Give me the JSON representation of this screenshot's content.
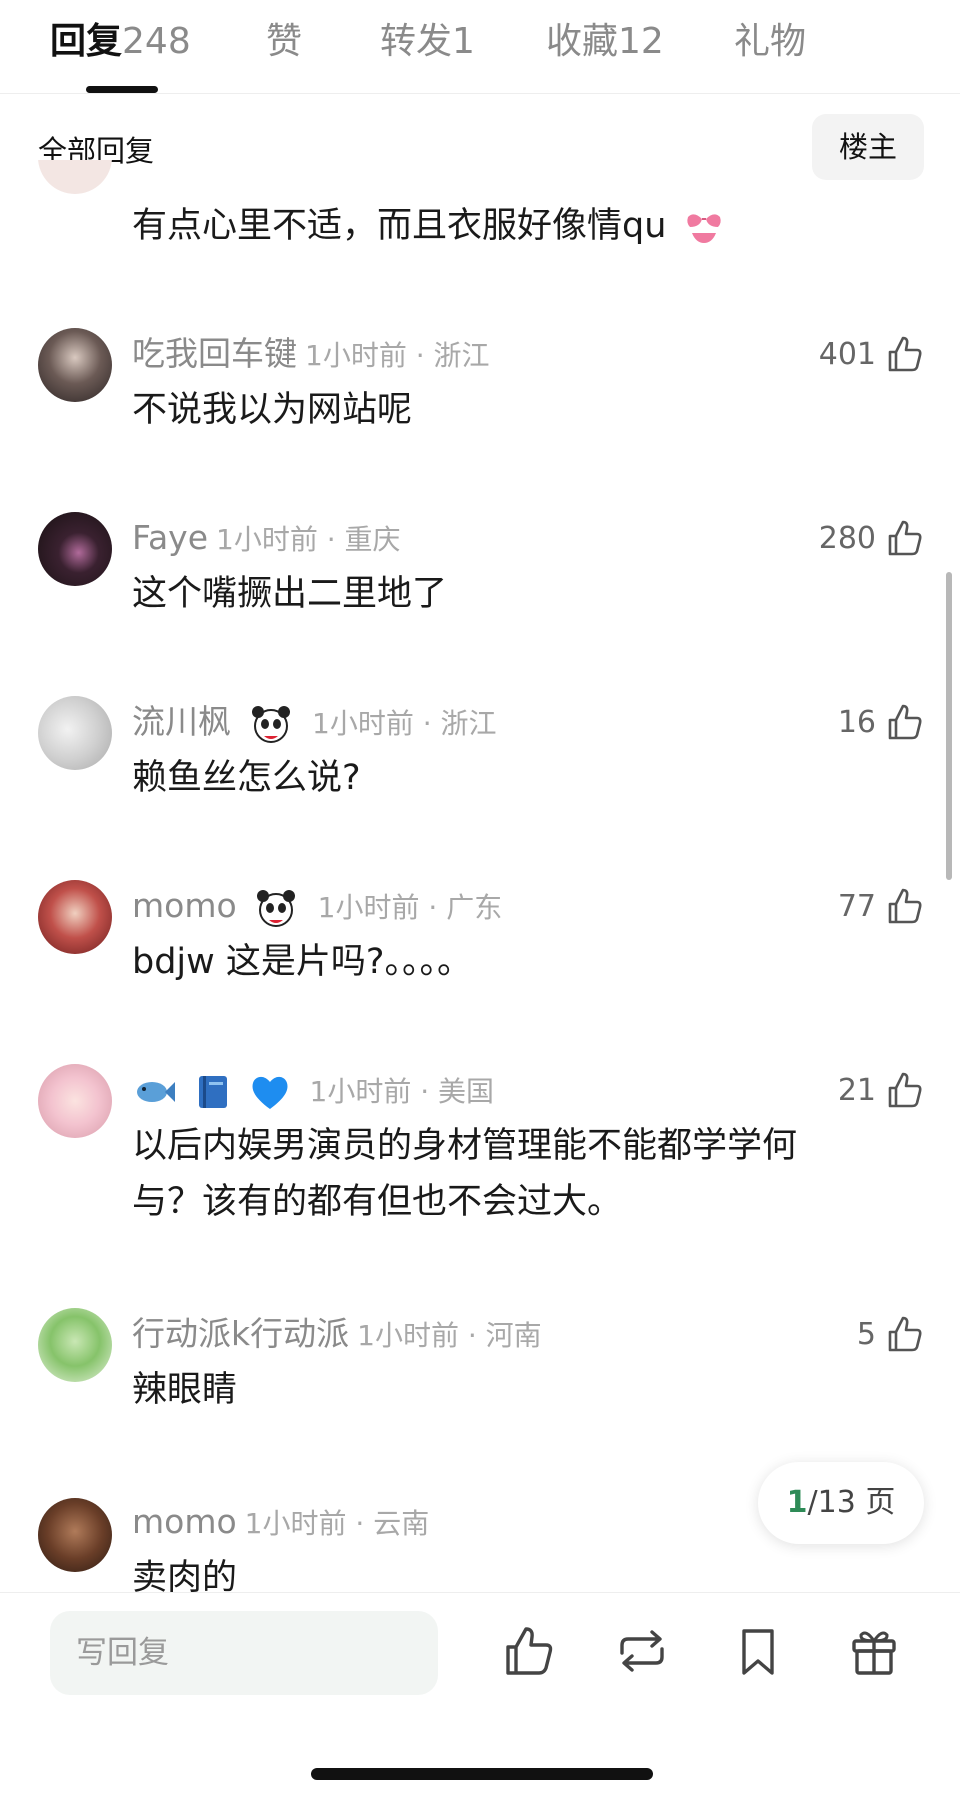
{
  "tabs": [
    {
      "label": "回复",
      "count": "248",
      "active": true
    },
    {
      "label": "赞",
      "count": "",
      "active": false
    },
    {
      "label": "转发",
      "count": "1",
      "active": false
    },
    {
      "label": "收藏",
      "count": "12",
      "active": false
    },
    {
      "label": "礼物",
      "count": "",
      "active": false
    }
  ],
  "section": {
    "title": "全部回复",
    "owner_button": "楼主"
  },
  "partial_comment": {
    "text": "有点心里不适，而且衣服好像情qu",
    "emoji": "bikini-emoji"
  },
  "comments": [
    {
      "user": "吃我回车键",
      "time": "1小时前",
      "location": "浙江",
      "likes": "401",
      "text": "不说我以为网站呢",
      "badges": []
    },
    {
      "user": "Faye",
      "time": "1小时前",
      "location": "重庆",
      "likes": "280",
      "text": "这个嘴撅出二里地了",
      "badges": []
    },
    {
      "user": "流川枫",
      "time": "1小时前",
      "location": "浙江",
      "likes": "16",
      "text": "赖鱼丝怎么说?",
      "badges": [
        "panda-badge-icon"
      ]
    },
    {
      "user": "momo",
      "time": "1小时前",
      "location": "广东",
      "likes": "77",
      "text": "bdjw 这是片吗?。。。。",
      "badges": [
        "panda-badge-icon"
      ]
    },
    {
      "user": "",
      "time": "1小时前",
      "location": "美国",
      "likes": "21",
      "text_line1": "以后内娱男演员的身材管理能不能都学学何",
      "text_line2": "与？该有的都有但也不会过大。",
      "badges": [
        "fish-icon",
        "book-icon",
        "blue-heart-icon"
      ]
    },
    {
      "user": "行动派k行动派",
      "time": "1小时前",
      "location": "河南",
      "likes": "5",
      "text": "辣眼睛",
      "badges": []
    },
    {
      "user": "momo",
      "time": "1小时前",
      "location": "云南",
      "likes": "",
      "text": "卖肉的",
      "badges": []
    }
  ],
  "pager": {
    "current": "1",
    "total_suffix": "/13 页"
  },
  "bottom_bar": {
    "reply_placeholder": "写回复",
    "actions": [
      "like-icon",
      "repost-icon",
      "bookmark-icon",
      "gift-icon"
    ]
  },
  "colors": {
    "accent_green": "#2e8b57",
    "muted": "#8a8a8a",
    "text": "#1a1a1a"
  }
}
